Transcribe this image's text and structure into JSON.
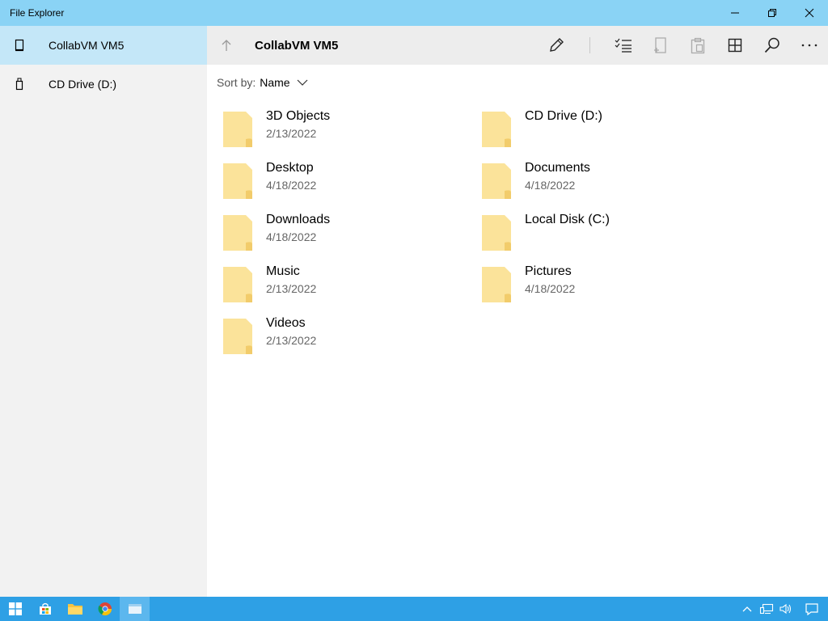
{
  "window": {
    "title": "File Explorer"
  },
  "sidebar": {
    "items": [
      {
        "label": "CollabVM VM5",
        "icon": "pc-icon",
        "active": true
      },
      {
        "label": "CD Drive (D:)",
        "icon": "usb-drive-icon",
        "active": false
      }
    ]
  },
  "location": {
    "title": "CollabVM VM5"
  },
  "toolbar": {
    "icons": [
      "rename-icon",
      "select-icon",
      "new-folder-icon",
      "paste-icon",
      "view-icon",
      "search-icon",
      "more-icon"
    ]
  },
  "sort": {
    "label": "Sort by:",
    "value": "Name"
  },
  "items": [
    {
      "name": "3D Objects",
      "date": "2/13/2022"
    },
    {
      "name": "CD Drive (D:)",
      "date": ""
    },
    {
      "name": "Desktop",
      "date": "4/18/2022"
    },
    {
      "name": "Documents",
      "date": "4/18/2022"
    },
    {
      "name": "Downloads",
      "date": "4/18/2022"
    },
    {
      "name": "Local Disk (C:)",
      "date": ""
    },
    {
      "name": "Music",
      "date": "2/13/2022"
    },
    {
      "name": "Pictures",
      "date": "4/18/2022"
    },
    {
      "name": "Videos",
      "date": "2/13/2022"
    }
  ],
  "colors": {
    "titlebar": "#8ad3f5",
    "sidebar_active": "#c4e7f8",
    "folder": "#fbe39a",
    "taskbar": "#2ea0e5"
  }
}
